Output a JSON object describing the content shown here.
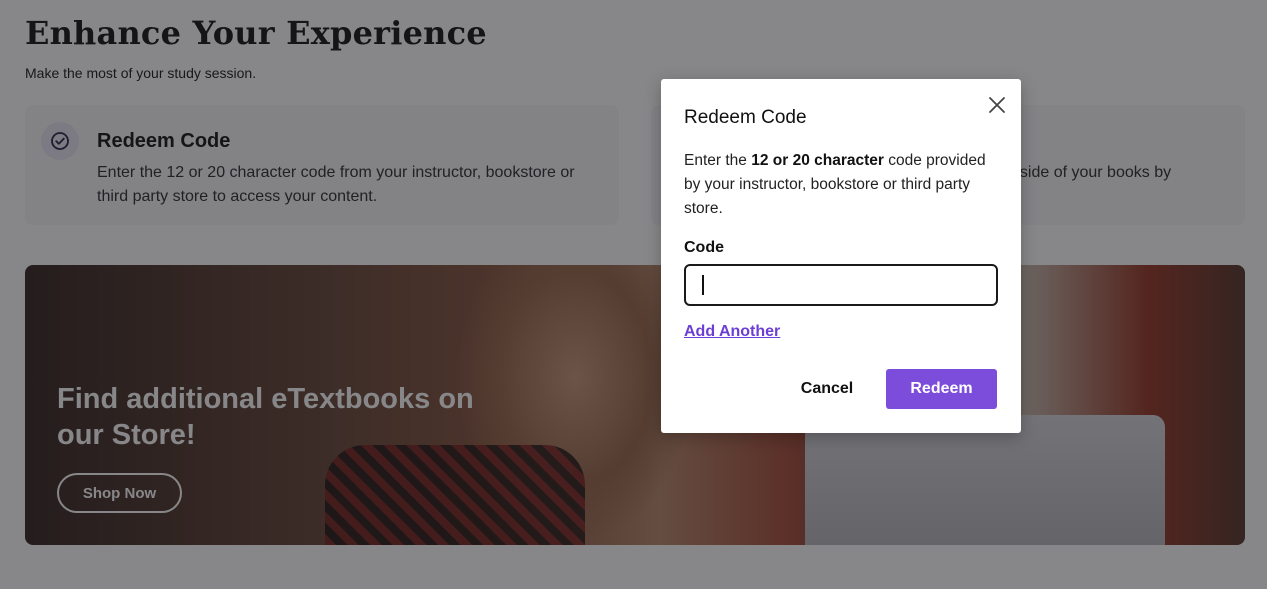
{
  "page": {
    "title": "Enhance Your Experience",
    "subtitle": "Make the most of your study session."
  },
  "cards": [
    {
      "title": "Redeem Code",
      "text": "Enter the 12 or 20 character code from your instructor, bookstore or third party store to access your content.",
      "icon": "check-circle-icon"
    },
    {
      "text": "nside of your books by"
    }
  ],
  "banner": {
    "headline": "Find additional eTextbooks on our Store!",
    "button_label": "Shop Now"
  },
  "modal": {
    "title": "Redeem Code",
    "desc_prefix": "Enter the ",
    "desc_bold": "12 or 20 character",
    "desc_suffix": " code provided by your instructor, bookstore or third party store.",
    "code_label": "Code",
    "code_value": "",
    "add_another": "Add Another",
    "cancel_label": "Cancel",
    "redeem_label": "Redeem"
  },
  "colors": {
    "accent": "#7c4ddb",
    "link": "#6b3fd4"
  }
}
